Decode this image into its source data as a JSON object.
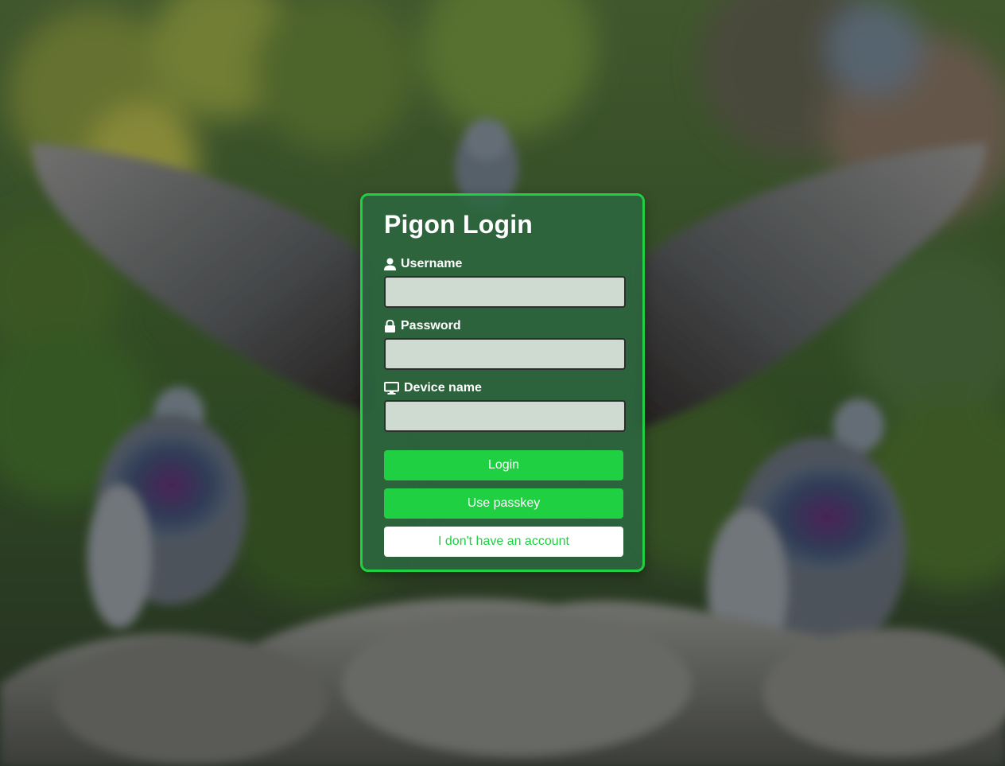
{
  "login_form": {
    "title": "Pigon Login",
    "fields": {
      "username": {
        "label": "Username",
        "icon": "user-icon",
        "value": ""
      },
      "password": {
        "label": "Password",
        "icon": "lock-icon",
        "value": ""
      },
      "device": {
        "label": "Device name",
        "icon": "monitor-icon",
        "value": ""
      }
    },
    "buttons": {
      "login": "Login",
      "passkey": "Use passkey",
      "no_account": "I don't have an account"
    }
  },
  "colors": {
    "accent": "#1fd042",
    "card_background": "#2c6840",
    "input_background": "#cfdad0",
    "secondary_button_background": "#ffffff"
  }
}
